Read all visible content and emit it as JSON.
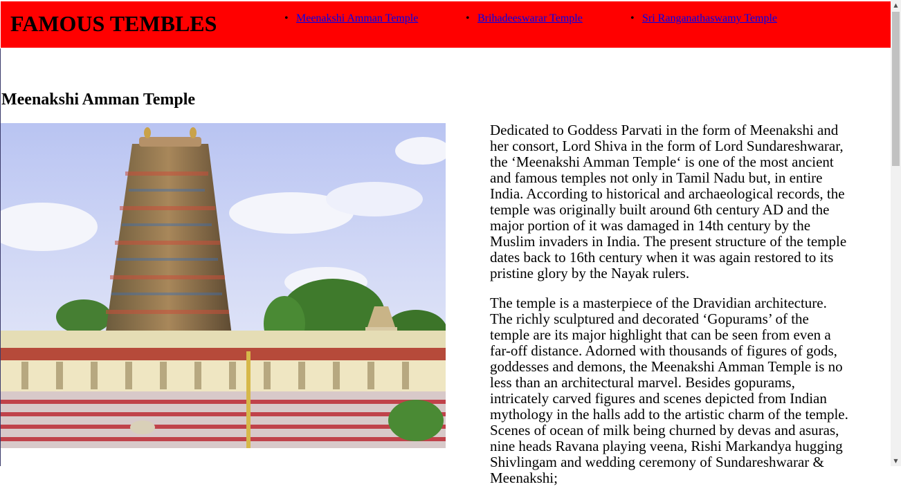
{
  "header": {
    "brand": "FAMOUS TEMBLES",
    "nav": [
      {
        "label": "Meenakshi Amman Temple"
      },
      {
        "label": "Brihadeeswarar Temple"
      },
      {
        "label": "Sri Ranganathaswamy Temple"
      }
    ],
    "background_color": "#ff0000",
    "link_color": "#0000ee"
  },
  "main": {
    "section_title": "Meenakshi Amman Temple",
    "image_icon": "temple-gopuram-photo",
    "paragraphs": [
      "Dedicated to Goddess Parvati in the form of Meenakshi and her consort, Lord Shiva in the form of Lord Sundareshwarar, the ‘Meenakshi Amman Temple‘ is one of the most ancient and famous temples not only in Tamil Nadu but, in entire India. According to historical and archaeological records, the temple was originally built around 6th century AD and the major portion of it was damaged in 14th century by the Muslim invaders in India. The present structure of the temple dates back to 16th century when it was again restored to its pristine glory by the Nayak rulers.",
      "The temple is a masterpiece of the Dravidian architecture. The richly sculptured and decorated ‘Gopurams’ of the temple are its major highlight that can be seen from even a far-off distance. Adorned with thousands of figures of gods, goddesses and demons, the Meenakshi Amman Temple is no less than an architectural marvel. Besides gopurams, intricately carved figures and scenes depicted from Indian mythology in the halls add to the artistic charm of the temple. Scenes of ocean of milk being churned by devas and asuras, nine heads Ravana playing veena, Rishi Markandya hugging Shivlingam and wedding ceremony of Sundareshwarar & Meenakshi;"
    ]
  },
  "scrollbar": {
    "up_icon": "▲",
    "down_icon": "▼"
  }
}
